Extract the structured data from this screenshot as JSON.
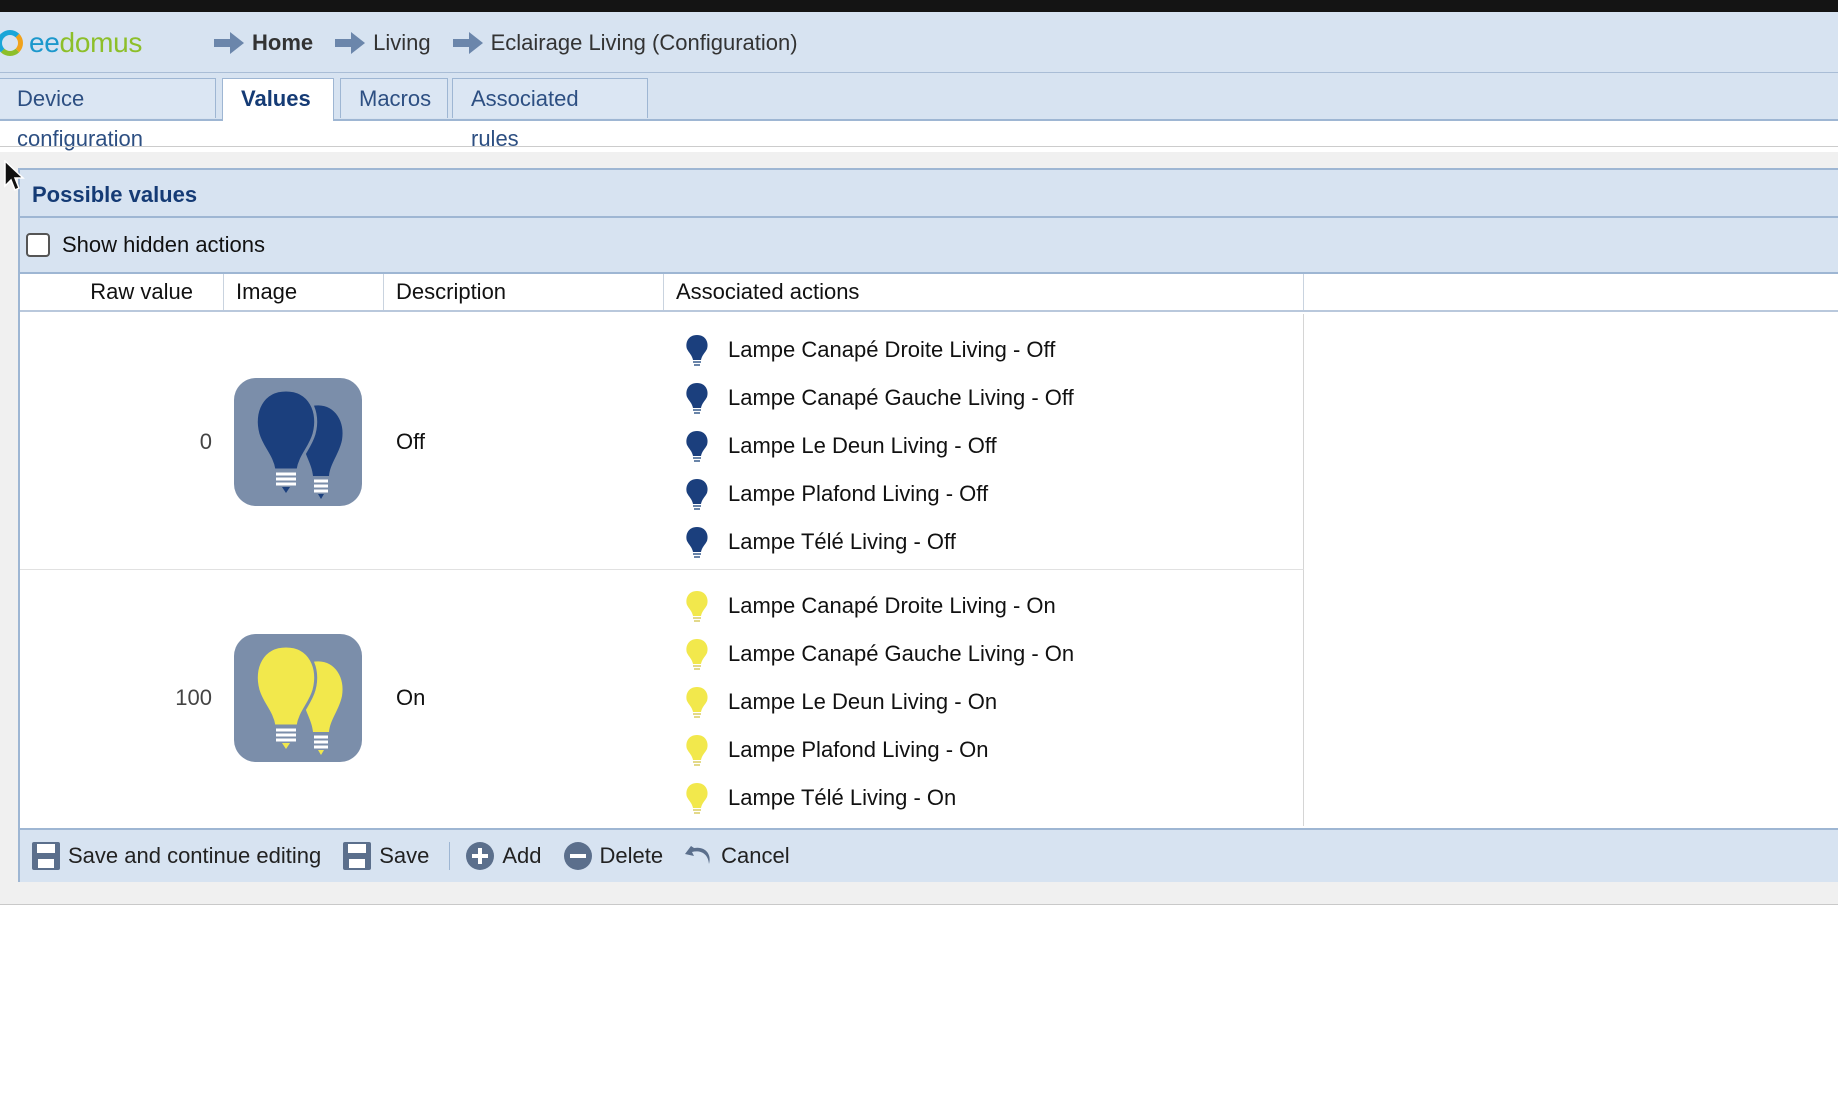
{
  "app": {
    "logo_text_main": "eedomus"
  },
  "breadcrumb": {
    "items": [
      "Home",
      "Living",
      "Eclairage Living (Configuration)"
    ]
  },
  "tabs": [
    {
      "label": "Device configuration",
      "active": false
    },
    {
      "label": "Values",
      "active": true
    },
    {
      "label": "Macros",
      "active": false
    },
    {
      "label": "Associated rules",
      "active": false
    }
  ],
  "panel": {
    "title": "Possible values",
    "show_hidden_label": "Show hidden actions",
    "show_hidden_checked": false
  },
  "columns": {
    "raw": "Raw value",
    "image": "Image",
    "description": "Description",
    "actions": "Associated actions"
  },
  "rows": [
    {
      "raw": "0",
      "description": "Off",
      "bulb_color": "#1b3f7d",
      "actions": [
        "Lampe Canapé Droite Living - Off",
        "Lampe Canapé Gauche Living - Off",
        "Lampe Le Deun Living - Off",
        "Lampe Plafond Living - Off",
        "Lampe Télé Living - Off"
      ]
    },
    {
      "raw": "100",
      "description": "On",
      "bulb_color": "#f2e84c",
      "actions": [
        "Lampe Canapé Droite Living - On",
        "Lampe Canapé Gauche Living - On",
        "Lampe Le Deun Living - On",
        "Lampe Plafond Living - On",
        "Lampe Télé Living - On"
      ]
    }
  ],
  "toolbar": {
    "save_continue": "Save and continue editing",
    "save": "Save",
    "add": "Add",
    "delete": "Delete",
    "cancel": "Cancel"
  },
  "colors": {
    "header_bg": "#d7e3f1",
    "accent": "#153b75",
    "border": "#9eb6d3"
  }
}
